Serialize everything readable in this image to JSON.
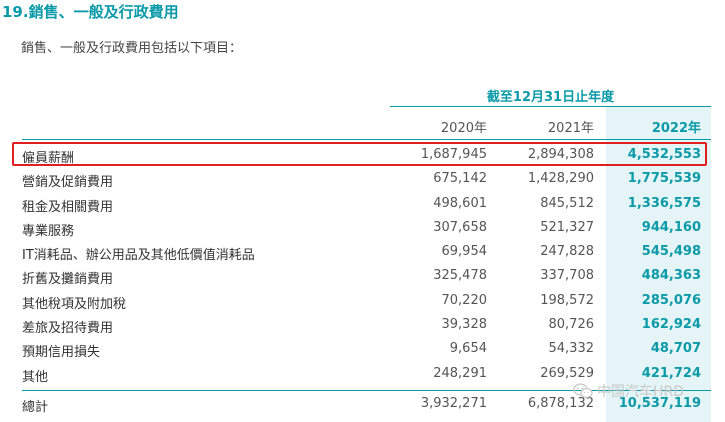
{
  "heading": {
    "title": "19.銷售、一般及行政費用",
    "subtitle": "銷售、一般及行政費用包括以下項目："
  },
  "table": {
    "period_label": "截至12月31日止年度",
    "columns": [
      "2020年",
      "2021年",
      "2022年"
    ],
    "rows": [
      {
        "label": "僱員薪酬",
        "values": [
          "1,687,945",
          "2,894,308",
          "4,532,553"
        ]
      },
      {
        "label": "營銷及促銷費用",
        "values": [
          "675,142",
          "1,428,290",
          "1,775,539"
        ]
      },
      {
        "label": "租金及相關費用",
        "values": [
          "498,601",
          "845,512",
          "1,336,575"
        ]
      },
      {
        "label": "專業服務",
        "values": [
          "307,658",
          "521,327",
          "944,160"
        ]
      },
      {
        "label": "IT消耗品、辦公用品及其他低價值消耗品",
        "values": [
          "69,954",
          "247,828",
          "545,498"
        ]
      },
      {
        "label": "折舊及攤銷費用",
        "values": [
          "325,478",
          "337,708",
          "484,363"
        ]
      },
      {
        "label": "其他稅項及附加稅",
        "values": [
          "70,220",
          "198,572",
          "285,076"
        ]
      },
      {
        "label": "差旅及招待費用",
        "values": [
          "39,328",
          "80,726",
          "162,924"
        ]
      },
      {
        "label": "預期信用損失",
        "values": [
          "9,654",
          "54,332",
          "48,707"
        ]
      },
      {
        "label": "其他",
        "values": [
          "248,291",
          "269,529",
          "421,724"
        ]
      }
    ],
    "total": {
      "label": "總計",
      "values": [
        "3,932,271",
        "6,878,132",
        "10,537,119"
      ]
    }
  },
  "watermark": {
    "text": "中国汽车HRD",
    "icon": "wechat-icon"
  },
  "colors": {
    "accent": "#0a9aa8",
    "highlight": "#e5f4f6",
    "annotation": "#e02020"
  }
}
